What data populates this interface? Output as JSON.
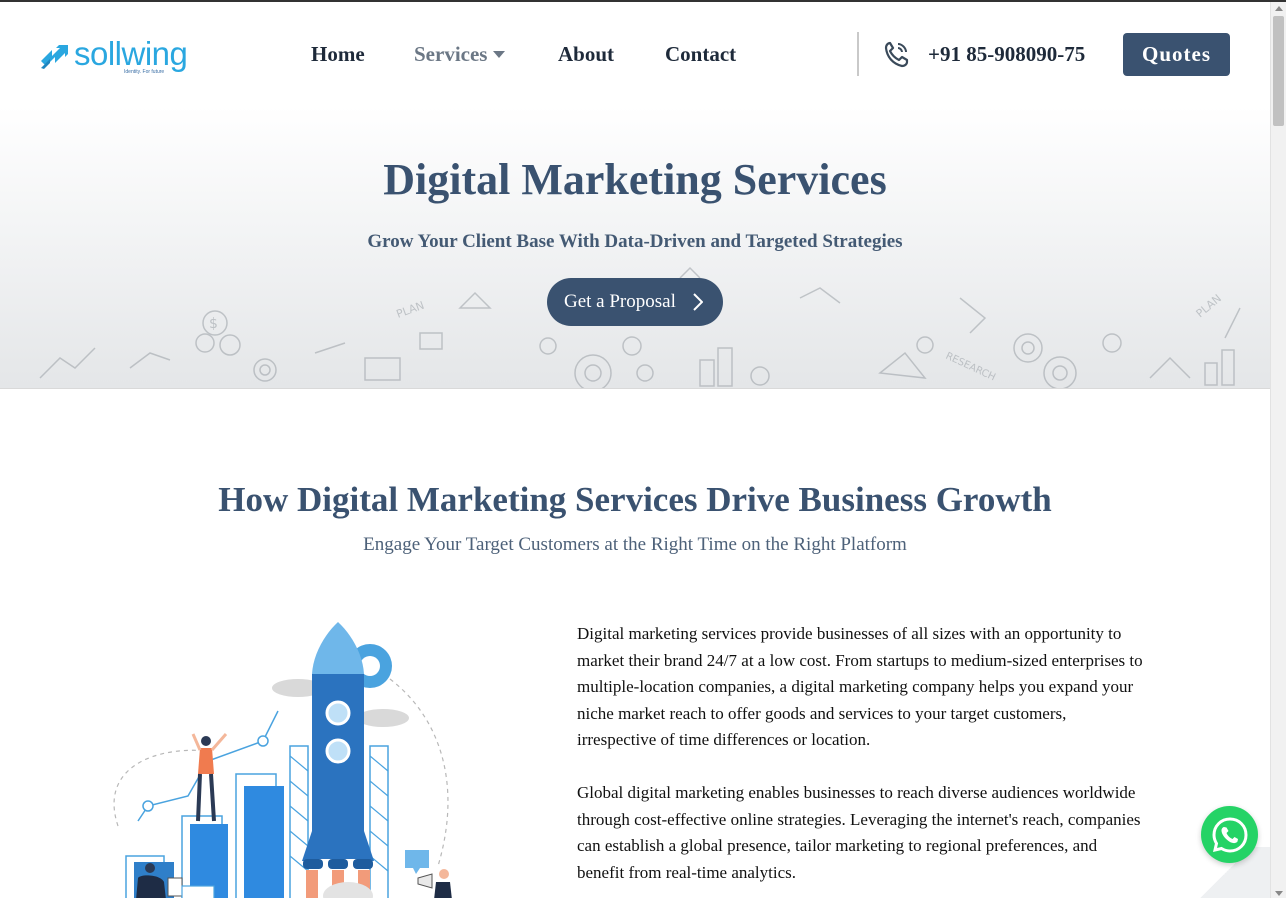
{
  "brand": {
    "name": "sollwing",
    "tagline": "Identity. For future",
    "primary_color": "#3a5270",
    "logo_color": "#2aa7e0"
  },
  "nav": {
    "items": [
      {
        "label": "Home"
      },
      {
        "label": "Services"
      },
      {
        "label": "About"
      },
      {
        "label": "Contact"
      }
    ],
    "phone": "+91 85-908090-75",
    "quotes_label": "Quotes"
  },
  "hero": {
    "title": "Digital Marketing Services",
    "subtitle": "Grow Your Client Base With Data-Driven and Targeted Strategies",
    "cta_label": "Get a Proposal"
  },
  "section": {
    "title": "How Digital Marketing Services Drive Business Growth",
    "subtitle": "Engage Your Target Customers at the Right Time on the Right Platform",
    "paragraphs": [
      "Digital marketing services provide businesses of all sizes with an opportunity to market their brand 24/7 at a low cost. From startups to medium-sized enterprises to multiple-location companies, a digital marketing company helps you expand your niche market reach to offer goods and services to your target customers, irrespective of time differences or location.",
      "Global digital marketing enables businesses to reach diverse audiences worldwide through cost-effective online strategies. Leveraging the internet's reach, companies can establish a global presence, tailor marketing to regional preferences, and benefit from real-time analytics."
    ]
  },
  "icons": {
    "phone": "phone-icon",
    "chevron": "chevron-right-icon",
    "whatsapp": "whatsapp-icon",
    "dropdown": "caret-down-icon"
  },
  "whatsapp_color": "#25d366"
}
